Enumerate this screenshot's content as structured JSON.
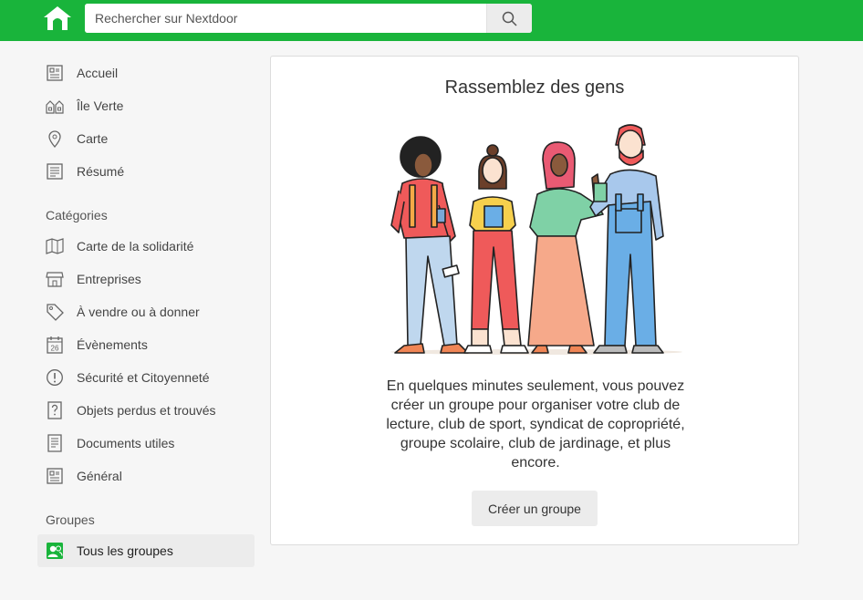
{
  "header": {
    "search_placeholder": "Rechercher sur Nextdoor",
    "brand_color": "#19b43b"
  },
  "sidebar": {
    "main_items": [
      {
        "label": "Accueil",
        "icon": "newsfeed-icon"
      },
      {
        "label": "Île Verte",
        "icon": "neighborhood-icon"
      },
      {
        "label": "Carte",
        "icon": "map-pin-icon"
      },
      {
        "label": "Résumé",
        "icon": "digest-icon"
      }
    ],
    "categories_title": "Catégories",
    "categories": [
      {
        "label": "Carte de la solidarité",
        "icon": "folded-map-icon"
      },
      {
        "label": "Entreprises",
        "icon": "storefront-icon"
      },
      {
        "label": "À vendre ou à donner",
        "icon": "price-tag-icon"
      },
      {
        "label": "Évènements",
        "icon": "calendar-icon",
        "badge": "26"
      },
      {
        "label": "Sécurité et Citoyenneté",
        "icon": "alert-icon"
      },
      {
        "label": "Objets perdus et trouvés",
        "icon": "question-icon"
      },
      {
        "label": "Documents utiles",
        "icon": "document-icon"
      },
      {
        "label": "Général",
        "icon": "general-icon"
      }
    ],
    "groups_title": "Groupes",
    "groups": [
      {
        "label": "Tous les groupes",
        "icon": "groups-icon",
        "active": true
      }
    ]
  },
  "card": {
    "title": "Rassemblez des gens",
    "description": "En quelques minutes seulement, vous pouvez créer un groupe pour organiser votre club de lecture, club de sport, syndicat de copropriété, groupe scolaire, club de jardinage, et plus encore.",
    "button_label": "Créer un groupe"
  }
}
